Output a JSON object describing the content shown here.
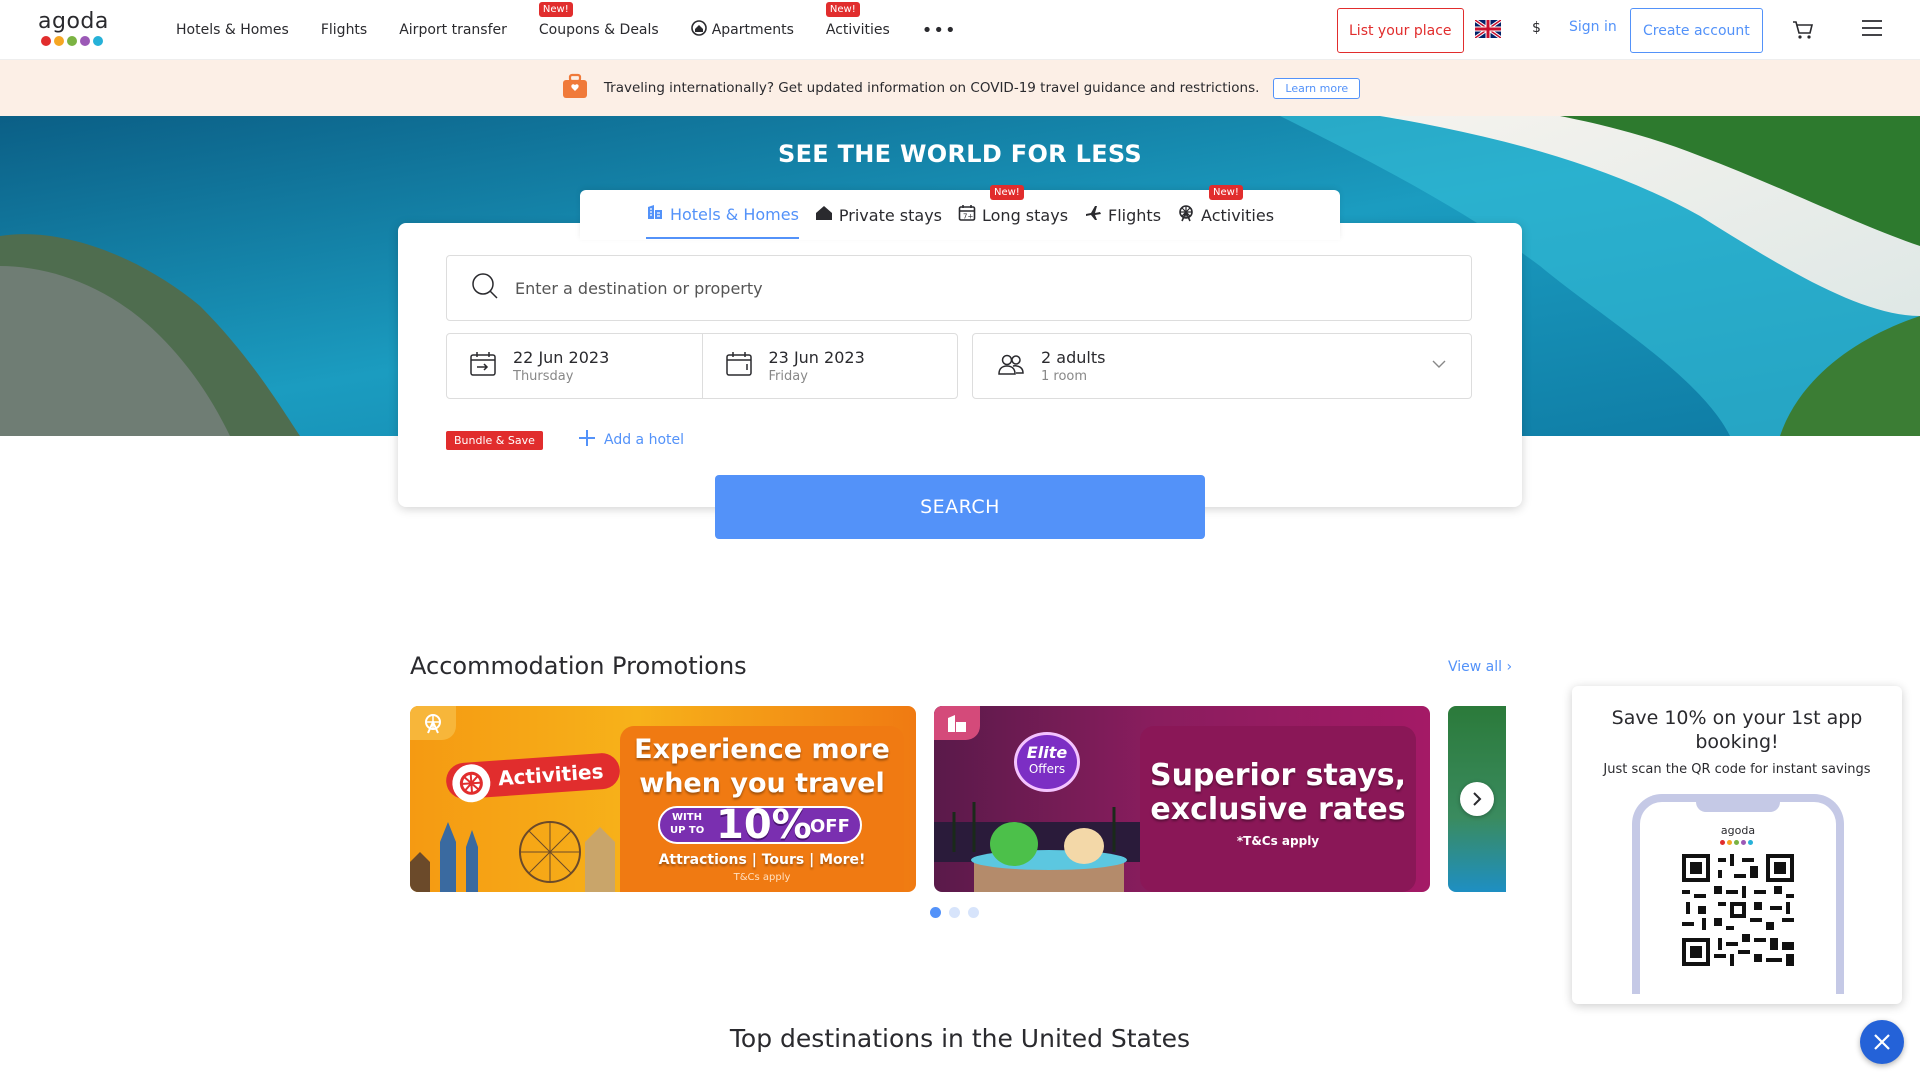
{
  "header": {
    "logo_text": "agoda",
    "logo_colors": [
      "#e12d2d",
      "#f5a623",
      "#7bb342",
      "#5392f9",
      "#9b59b6"
    ],
    "nav": [
      {
        "label": "Hotels & Homes",
        "badge": ""
      },
      {
        "label": "Flights",
        "badge": ""
      },
      {
        "label": "Airport transfer",
        "badge": ""
      },
      {
        "label": "Coupons & Deals",
        "badge": "New!"
      },
      {
        "label": "Apartments",
        "badge": ""
      },
      {
        "label": "Activities",
        "badge": "New!"
      }
    ],
    "more_label": "•••",
    "list_place": "List your place",
    "currency": "$",
    "sign_in": "Sign in",
    "create_account": "Create account"
  },
  "covid": {
    "text": "Traveling internationally? Get updated information on COVID-19 travel guidance and restrictions.",
    "learn_more": "Learn more"
  },
  "hero": {
    "title": "SEE THE WORLD FOR LESS"
  },
  "search": {
    "tabs": [
      {
        "label": "Hotels & Homes",
        "badge": "",
        "active": true
      },
      {
        "label": "Private stays",
        "badge": "",
        "active": false
      },
      {
        "label": "Long stays",
        "badge": "New!",
        "active": false
      },
      {
        "label": "Flights",
        "badge": "",
        "active": false
      },
      {
        "label": "Activities",
        "badge": "New!",
        "active": false
      }
    ],
    "destination_placeholder": "Enter a destination or property",
    "checkin": {
      "date": "22 Jun 2023",
      "day": "Thursday"
    },
    "checkout": {
      "date": "23 Jun 2023",
      "day": "Friday"
    },
    "guests": {
      "main": "2 adults",
      "sub": "1 room"
    },
    "bundle_label": "Bundle & Save",
    "add_hotel": "Add a hotel",
    "search_button": "SEARCH"
  },
  "promotions": {
    "title": "Accommodation Promotions",
    "view_all": "View all ›",
    "card1": {
      "tag": "Activities",
      "headline1": "Experience more",
      "headline2": "when you travel",
      "offer_prefix1": "WITH",
      "offer_prefix2": "UP TO",
      "offer_value": "10%",
      "offer_suffix": "OFF",
      "subline": "Attractions | Tours | More!",
      "terms": "T&Cs apply"
    },
    "card2": {
      "badge_line1": "Elite",
      "badge_line2": "Offers",
      "headline1": "Superior stays,",
      "headline2": "exclusive rates",
      "terms": "*T&Cs apply"
    },
    "pager_total": 3,
    "pager_active": 1
  },
  "top_destinations": {
    "title": "Top destinations in the United States"
  },
  "app_popup": {
    "title": "Save 10% on your 1st app booking!",
    "subtitle": "Just scan the QR code for instant savings",
    "phone_logo": "agoda"
  }
}
